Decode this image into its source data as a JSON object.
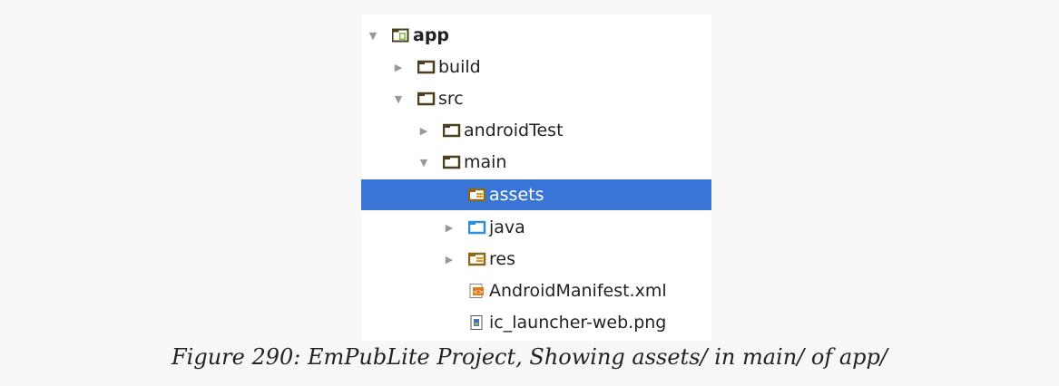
{
  "tree": {
    "items": [
      {
        "label": "app",
        "expanded": true,
        "icon": "module-folder-icon"
      },
      {
        "label": "build",
        "expanded": false,
        "icon": "folder-icon"
      },
      {
        "label": "src",
        "expanded": true,
        "icon": "folder-icon"
      },
      {
        "label": "androidTest",
        "expanded": false,
        "icon": "folder-icon"
      },
      {
        "label": "main",
        "expanded": true,
        "icon": "folder-icon"
      },
      {
        "label": "assets",
        "selected": true,
        "icon": "resource-folder-icon"
      },
      {
        "label": "java",
        "expanded": false,
        "icon": "source-folder-icon"
      },
      {
        "label": "res",
        "expanded": false,
        "icon": "resource-folder-icon"
      },
      {
        "label": "AndroidManifest.xml",
        "icon": "xml-file-icon"
      },
      {
        "label": "ic_launcher-web.png",
        "icon": "image-file-icon"
      }
    ]
  },
  "caption": "Figure 290: EmPubLite Project, Showing assets/ in main/ of app/",
  "colors": {
    "selection": "#3875d7",
    "folder": "#4a3f1f",
    "source_folder": "#2f8fcf",
    "resource_folder": "#d89a18"
  }
}
